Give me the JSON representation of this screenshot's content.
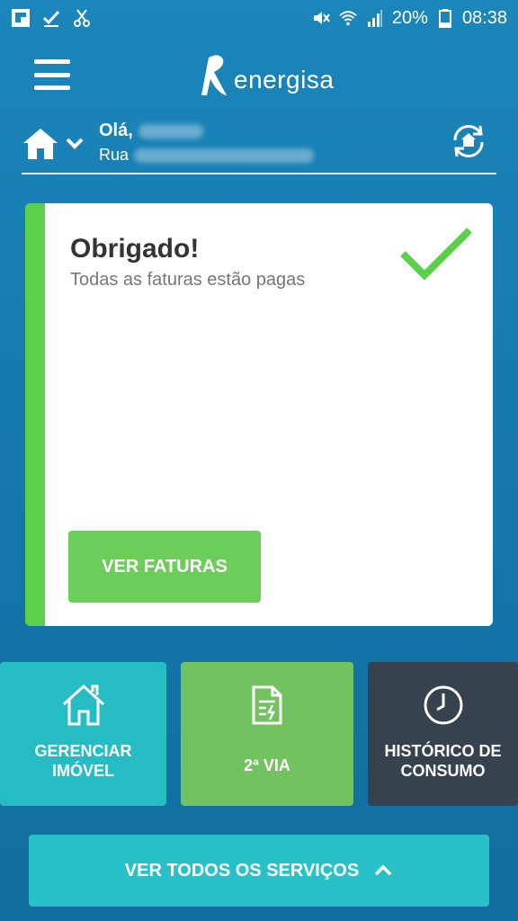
{
  "status_bar": {
    "battery": "20%",
    "time": "08:38",
    "icons_left": [
      "flipboard-icon",
      "check-icon",
      "scissors-icon"
    ],
    "icons_right": [
      "mute-icon",
      "wifi-icon",
      "signal-icon",
      "battery-icon"
    ]
  },
  "header": {
    "logo_text": "energisa"
  },
  "account": {
    "greeting": "Olá,",
    "address": "Rua"
  },
  "card": {
    "title": "Obrigado!",
    "subtitle": "Todas as faturas estão pagas",
    "button_label": "VER FATURAS"
  },
  "tiles": [
    {
      "label": "GERENCIAR\nIMÓVEL",
      "icon": "house-icon",
      "color": "#26bcc4"
    },
    {
      "label": "2ª VIA",
      "icon": "document-icon",
      "color": "#72c35f"
    },
    {
      "label": "HISTÓRICO DE\nCONSUMO",
      "icon": "clock-icon",
      "color": "#36434e"
    }
  ],
  "footer_button": {
    "label": "VER TODOS OS SERVIÇOS"
  },
  "colors": {
    "background": "#1679ad",
    "accent_green": "#5bd04a",
    "card_background": "#ffffff"
  }
}
